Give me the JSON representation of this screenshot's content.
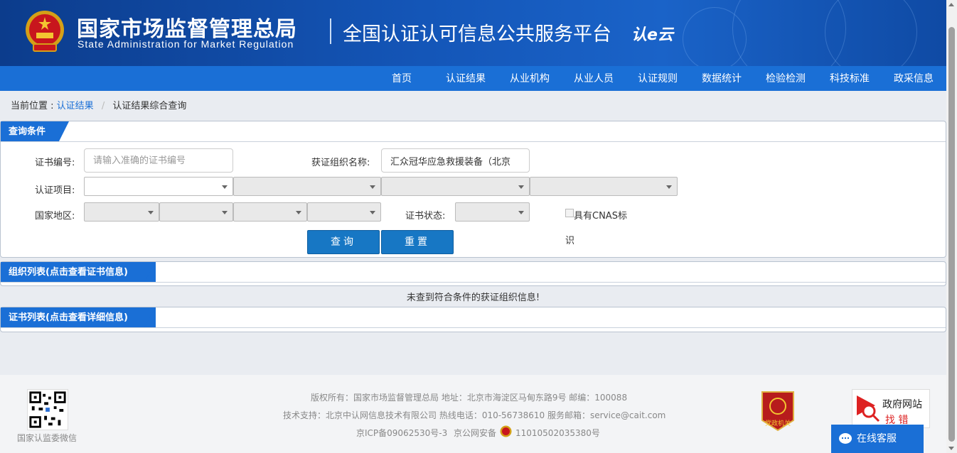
{
  "header": {
    "org_cn": "国家市场监督管理总局",
    "org_en": "State Administration  for  Market Regulation",
    "platform": "全国认证认可信息公共服务平台",
    "logo_text": "认e云"
  },
  "nav": {
    "items": [
      "首页",
      "认证结果",
      "从业机构",
      "从业人员",
      "认证规则",
      "数据统计",
      "检验检测",
      "科技标准",
      "政采信息"
    ]
  },
  "breadcrumb": {
    "prefix": "当前位置 :",
    "link": "认证结果",
    "sep": "/",
    "current": "认证结果综合查询"
  },
  "query": {
    "title": "查询条件",
    "cert_no_label": "证书编号:",
    "cert_no_placeholder": "请输入准确的证书编号",
    "org_name_label": "获证组织名称:",
    "org_name_value": "汇众冠华应急救援装备（北京",
    "project_label": "认证项目:",
    "region_label": "国家地区:",
    "status_label": "证书状态:",
    "cnas_label_1": "具有CNAS标",
    "cnas_label_2": "识",
    "search_btn": "查询",
    "reset_btn": "重置"
  },
  "org_list": {
    "title": "组织列表(点击查看证书信息)",
    "empty": "未查到符合条件的获证组织信息!"
  },
  "cert_list": {
    "title": "证书列表(点击查看详细信息)"
  },
  "footer": {
    "qr_label": "国家认监委微信",
    "line1": "版权所有：国家市场监督管理总局    地址：北京市海淀区马甸东路9号    邮编：100088",
    "line2": "技术支持：北京中认网信息技术有限公司    热线电话：010-56738610    服务邮箱：service@cait.com",
    "icp": "京ICP备09062530号-3",
    "police": "京公网安备",
    "police_no": "11010502035380号",
    "party_badge": "党政机关",
    "gov_err_1": "政府网站",
    "gov_err_2": "找 错",
    "online_cs": "在线客服"
  },
  "colors": {
    "header_bg": "#1456b8",
    "nav_bg": "#1a6fd6",
    "button_bg": "#1777c4",
    "page_bg": "#e9ecf1"
  }
}
